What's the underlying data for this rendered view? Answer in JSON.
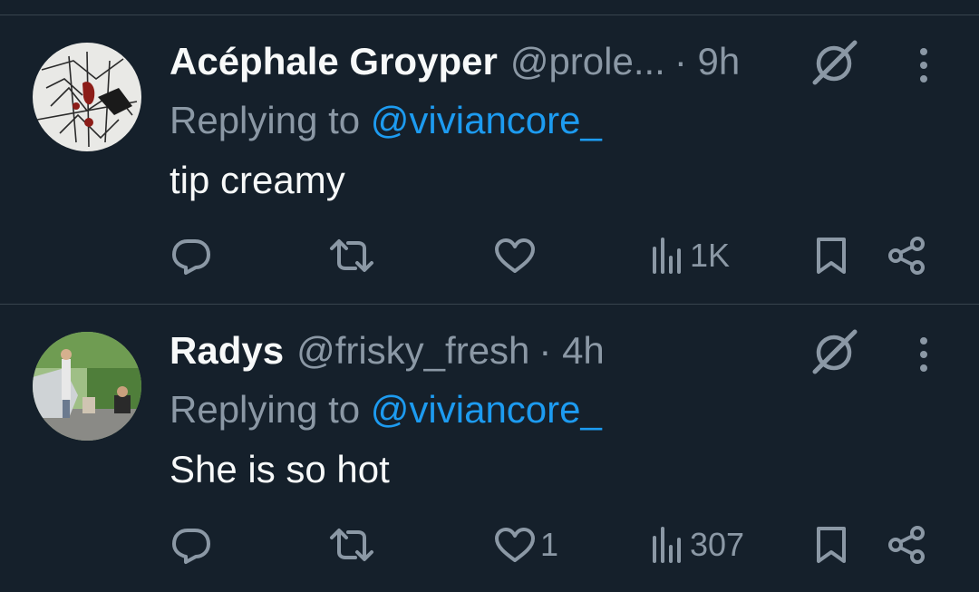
{
  "colors": {
    "background": "#15202b",
    "primary_text": "#f7f9f9",
    "secondary_text": "#8b98a5",
    "link": "#1d9bf0",
    "divider": "#38444d"
  },
  "tweets": [
    {
      "author_name": "Acéphale Groyper",
      "handle": "@prole...",
      "time": "· 9h",
      "replying_prefix": "Replying to ",
      "replying_to": "@viviancore_",
      "text": "tip creamy",
      "likes": "",
      "views": "1K",
      "avatar": "abstract-artwork-avatar"
    },
    {
      "author_name": "Radys",
      "handle": "@frisky_fresh",
      "time": "· 4h",
      "replying_prefix": "Replying to ",
      "replying_to": "@viviancore_",
      "text": "She is so hot",
      "likes": "1",
      "views": "307",
      "avatar": "outdoor-photo-avatar"
    }
  ],
  "icons": [
    "reply-icon",
    "retweet-icon",
    "like-icon",
    "views-icon",
    "bookmark-icon",
    "share-icon",
    "grok-icon",
    "more-icon"
  ]
}
